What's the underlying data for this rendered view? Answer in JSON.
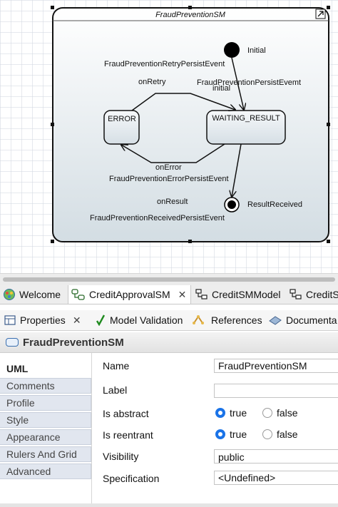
{
  "diagram": {
    "title": "FraudPreventionSM",
    "states": {
      "error": "ERROR",
      "waiting": "WAITING_RESULT"
    },
    "pseudo": {
      "initial_label": "Initial",
      "final_label": "ResultReceived"
    },
    "transitions": {
      "retry_event": "FraudPreventionRetryPersistEvent",
      "retry_trigger": "onRetry",
      "persist_event": "FraudPreventionPersistEvemt",
      "persist_trigger": "initial",
      "error_trigger": "onError",
      "error_event": "FraudPreventionErrorPersistEvent",
      "result_trigger": "onResult",
      "result_event": "FraudPreventionReceivedPersistEvent"
    }
  },
  "editor_tabs": [
    {
      "label": "Welcome",
      "icon": "welcome-globe-icon"
    },
    {
      "label": "CreditApprovalSM",
      "icon": "state-machine-icon",
      "active": true
    },
    {
      "label": "CreditSMModel",
      "icon": "model-icon"
    },
    {
      "label": "CreditS",
      "icon": "model-icon"
    }
  ],
  "view_tabs": [
    {
      "label": "Properties",
      "icon": "properties-icon"
    },
    {
      "label": "Model Validation",
      "icon": "check-icon"
    },
    {
      "label": "References",
      "icon": "references-icon"
    },
    {
      "label": "Documenta",
      "icon": "documentation-icon"
    }
  ],
  "element": {
    "name": "FraudPreventionSM"
  },
  "categories": [
    "UML",
    "Comments",
    "Profile",
    "Style",
    "Appearance",
    "Rulers And Grid",
    "Advanced"
  ],
  "properties": {
    "name_label": "Name",
    "name_value": "FraudPreventionSM",
    "label_label": "Label",
    "label_value": "",
    "abstract_label": "Is abstract",
    "reentrant_label": "Is reentrant",
    "true_label": "true",
    "false_label": "false",
    "visibility_label": "Visibility",
    "visibility_value": "public",
    "specification_label": "Specification",
    "specification_value": "<Undefined>"
  },
  "colors": {
    "accent": "#1a73e8",
    "state_fill_top": "#f4f6f8",
    "state_fill_bottom": "#d2dce2"
  }
}
